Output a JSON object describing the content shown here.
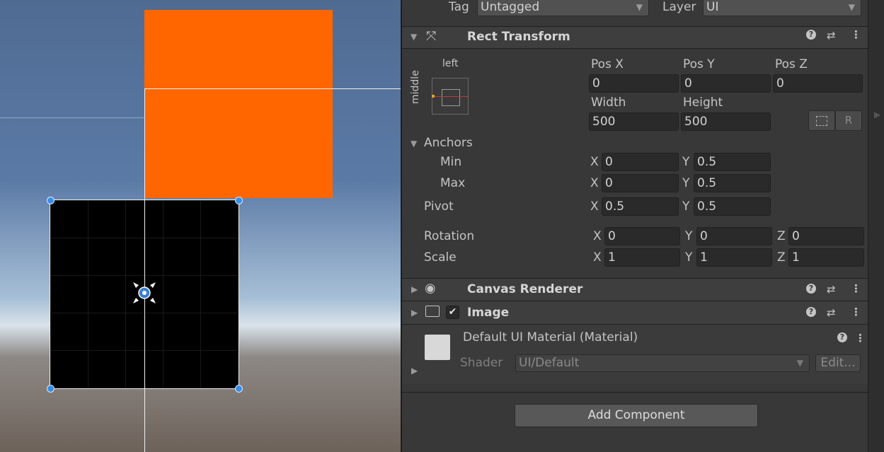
{
  "header": {
    "tag_label": "Tag",
    "tag_value": "Untagged",
    "layer_label": "Layer",
    "layer_value": "UI"
  },
  "rect_transform": {
    "title": "Rect Transform",
    "anchor_preset_h": "left",
    "anchor_preset_v": "middle",
    "pos_x_label": "Pos X",
    "pos_y_label": "Pos Y",
    "pos_z_label": "Pos Z",
    "pos_x": "0",
    "pos_y": "0",
    "pos_z": "0",
    "width_label": "Width",
    "height_label": "Height",
    "width": "500",
    "height": "500",
    "raw_edit_glyph": "R",
    "anchors_label": "Anchors",
    "min_label": "Min",
    "max_label": "Max",
    "min_x": "0",
    "min_y": "0.5",
    "max_x": "0",
    "max_y": "0.5",
    "pivot_label": "Pivot",
    "pivot_x": "0.5",
    "pivot_y": "0.5",
    "rotation_label": "Rotation",
    "rot_x": "0",
    "rot_y": "0",
    "rot_z": "0",
    "scale_label": "Scale",
    "scale_x": "1",
    "scale_y": "1",
    "scale_z": "1",
    "axis_x": "X",
    "axis_y": "Y",
    "axis_z": "Z"
  },
  "canvas_renderer": {
    "title": "Canvas Renderer"
  },
  "image": {
    "title": "Image",
    "enabled": true
  },
  "material": {
    "name": "Default UI Material (Material)",
    "shader_label": "Shader",
    "shader_value": "UI/Default",
    "edit_label": "Edit..."
  },
  "add_component_label": "Add Component",
  "colors": {
    "orange_square": "#ff6600",
    "black_square": "#000000",
    "handle_blue": "#3a8ee6",
    "inspector_bg": "#383838"
  }
}
